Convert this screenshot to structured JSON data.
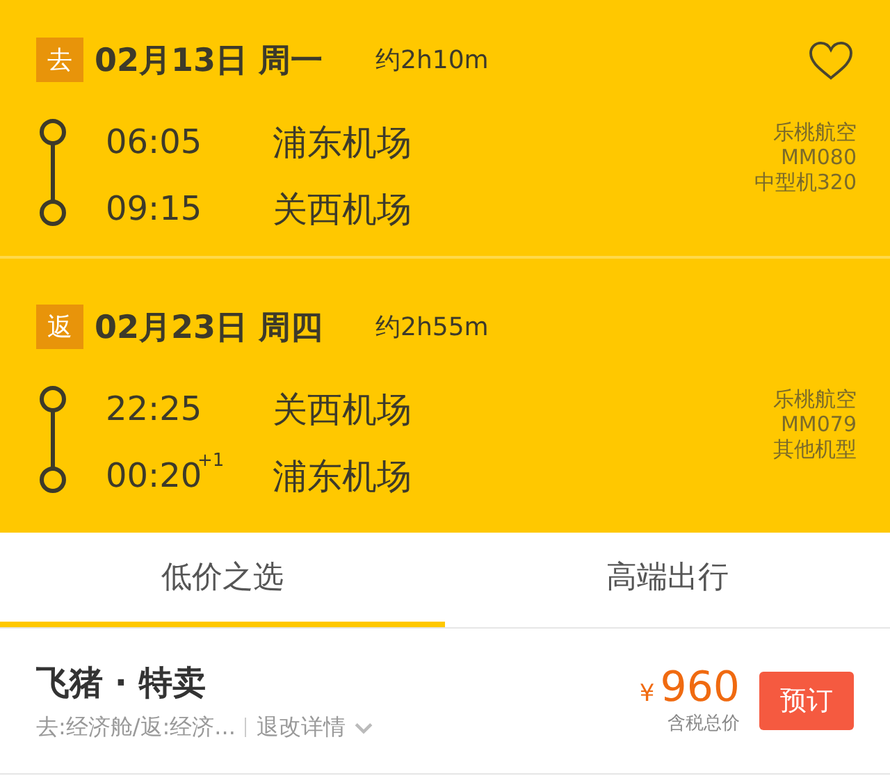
{
  "segments": [
    {
      "tag": "去",
      "date": "02月13日 周一",
      "duration": "约2h10m",
      "favorite": false,
      "stops": [
        {
          "time": "06:05",
          "airport": "浦东机场"
        },
        {
          "time": "09:15",
          "airport": "关西机场"
        }
      ],
      "info": [
        "乐桃航空",
        "MM080",
        "中型机320"
      ]
    },
    {
      "tag": "返",
      "date": "02月23日 周四",
      "duration": "约2h55m",
      "stops": [
        {
          "time": "22:25",
          "airport": "关西机场"
        },
        {
          "time": "00:20",
          "day_offset": "+1",
          "airport": "浦东机场"
        }
      ],
      "info": [
        "乐桃航空",
        "MM079",
        "其他机型"
      ]
    }
  ],
  "tabs": [
    {
      "label": "低价之选",
      "selected": true
    },
    {
      "label": "高端出行",
      "selected": false
    }
  ],
  "offer": {
    "brand": "飞猪 · 特卖",
    "cabin": "去:经济舱/返:经济...",
    "link": "退改详情",
    "currency": "¥",
    "price": "960",
    "price_note": "含税总价",
    "button": "预订"
  }
}
